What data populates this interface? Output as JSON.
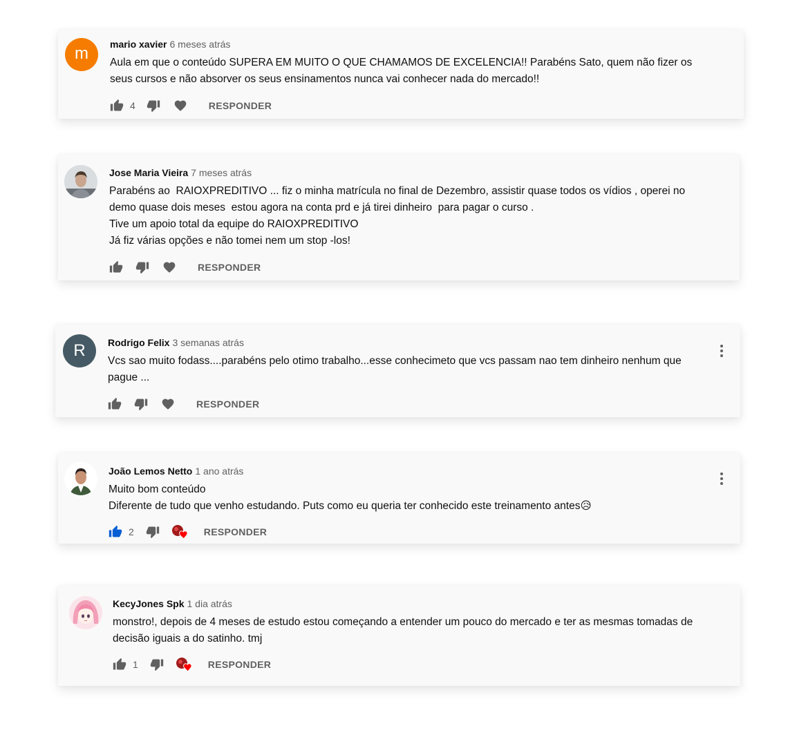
{
  "colors": {
    "card_bg": "#f9f9f9",
    "text": "#0f0f0f",
    "muted": "#606060",
    "like_active": "#065fd4",
    "heart_red": "#ff0000"
  },
  "reply_label": "RESPONDER",
  "comments": [
    {
      "author": "mario xavier",
      "time": "6 meses atrás",
      "avatar": {
        "type": "initial",
        "letter": "m",
        "color": "#f57c00"
      },
      "text": "Aula em que o conteúdo SUPERA EM MUITO O QUE CHAMAMOS DE EXCELENCIA!! Parabéns Sato, quem não fizer os\nseus cursos e não absorver os seus ensinamentos nunca vai conhecer nada do mercado!!",
      "likes": "4",
      "liked": false,
      "heart": "plain",
      "has_menu": false
    },
    {
      "author": "Jose Maria Vieira",
      "time": "7 meses atrás",
      "avatar": {
        "type": "photo",
        "icon": "person-photo-icon"
      },
      "text": "Parabéns ao  RAIOXPREDITIVO ... fiz o minha matrícula no final de Dezembro, assistir quase todos os vídios , operei no\ndemo quase dois meses  estou agora na conta prd e já tirei dinheiro  para pagar o curso .\nTive um apoio total da equipe do RAIOXPREDITIVO\nJá fiz várias opções e não tomei nem um stop -los!",
      "likes": "",
      "liked": false,
      "heart": "plain",
      "has_menu": false
    },
    {
      "author": "Rodrigo Felix",
      "time": "3 semanas atrás",
      "avatar": {
        "type": "initial",
        "letter": "R",
        "color": "#455a64"
      },
      "text": "Vcs sao muito fodass....parabéns pelo otimo trabalho...esse conhecimeto que vcs passam nao tem dinheiro nenhum que\npague ...",
      "likes": "",
      "liked": false,
      "heart": "plain",
      "has_menu": true
    },
    {
      "author": "João Lemos Netto",
      "time": "1 ano atrás",
      "avatar": {
        "type": "photo",
        "icon": "person-photo-icon"
      },
      "text": "Muito bom conteúdo\nDiferente de tudo que venho estudando. Puts como eu queria ter conhecido este treinamento antes😥",
      "likes": "2",
      "liked": true,
      "heart": "creator",
      "has_menu": true
    },
    {
      "author": "KecyJones Spk",
      "time": "1 dia atrás",
      "avatar": {
        "type": "photo",
        "icon": "anime-avatar-icon"
      },
      "text": "monstro!, depois de 4 meses de estudo estou começando a entender um pouco do mercado e ter as mesmas tomadas de\ndecisão iguais a do satinho. tmj",
      "likes": "1",
      "liked": false,
      "heart": "creator",
      "has_menu": false
    }
  ]
}
